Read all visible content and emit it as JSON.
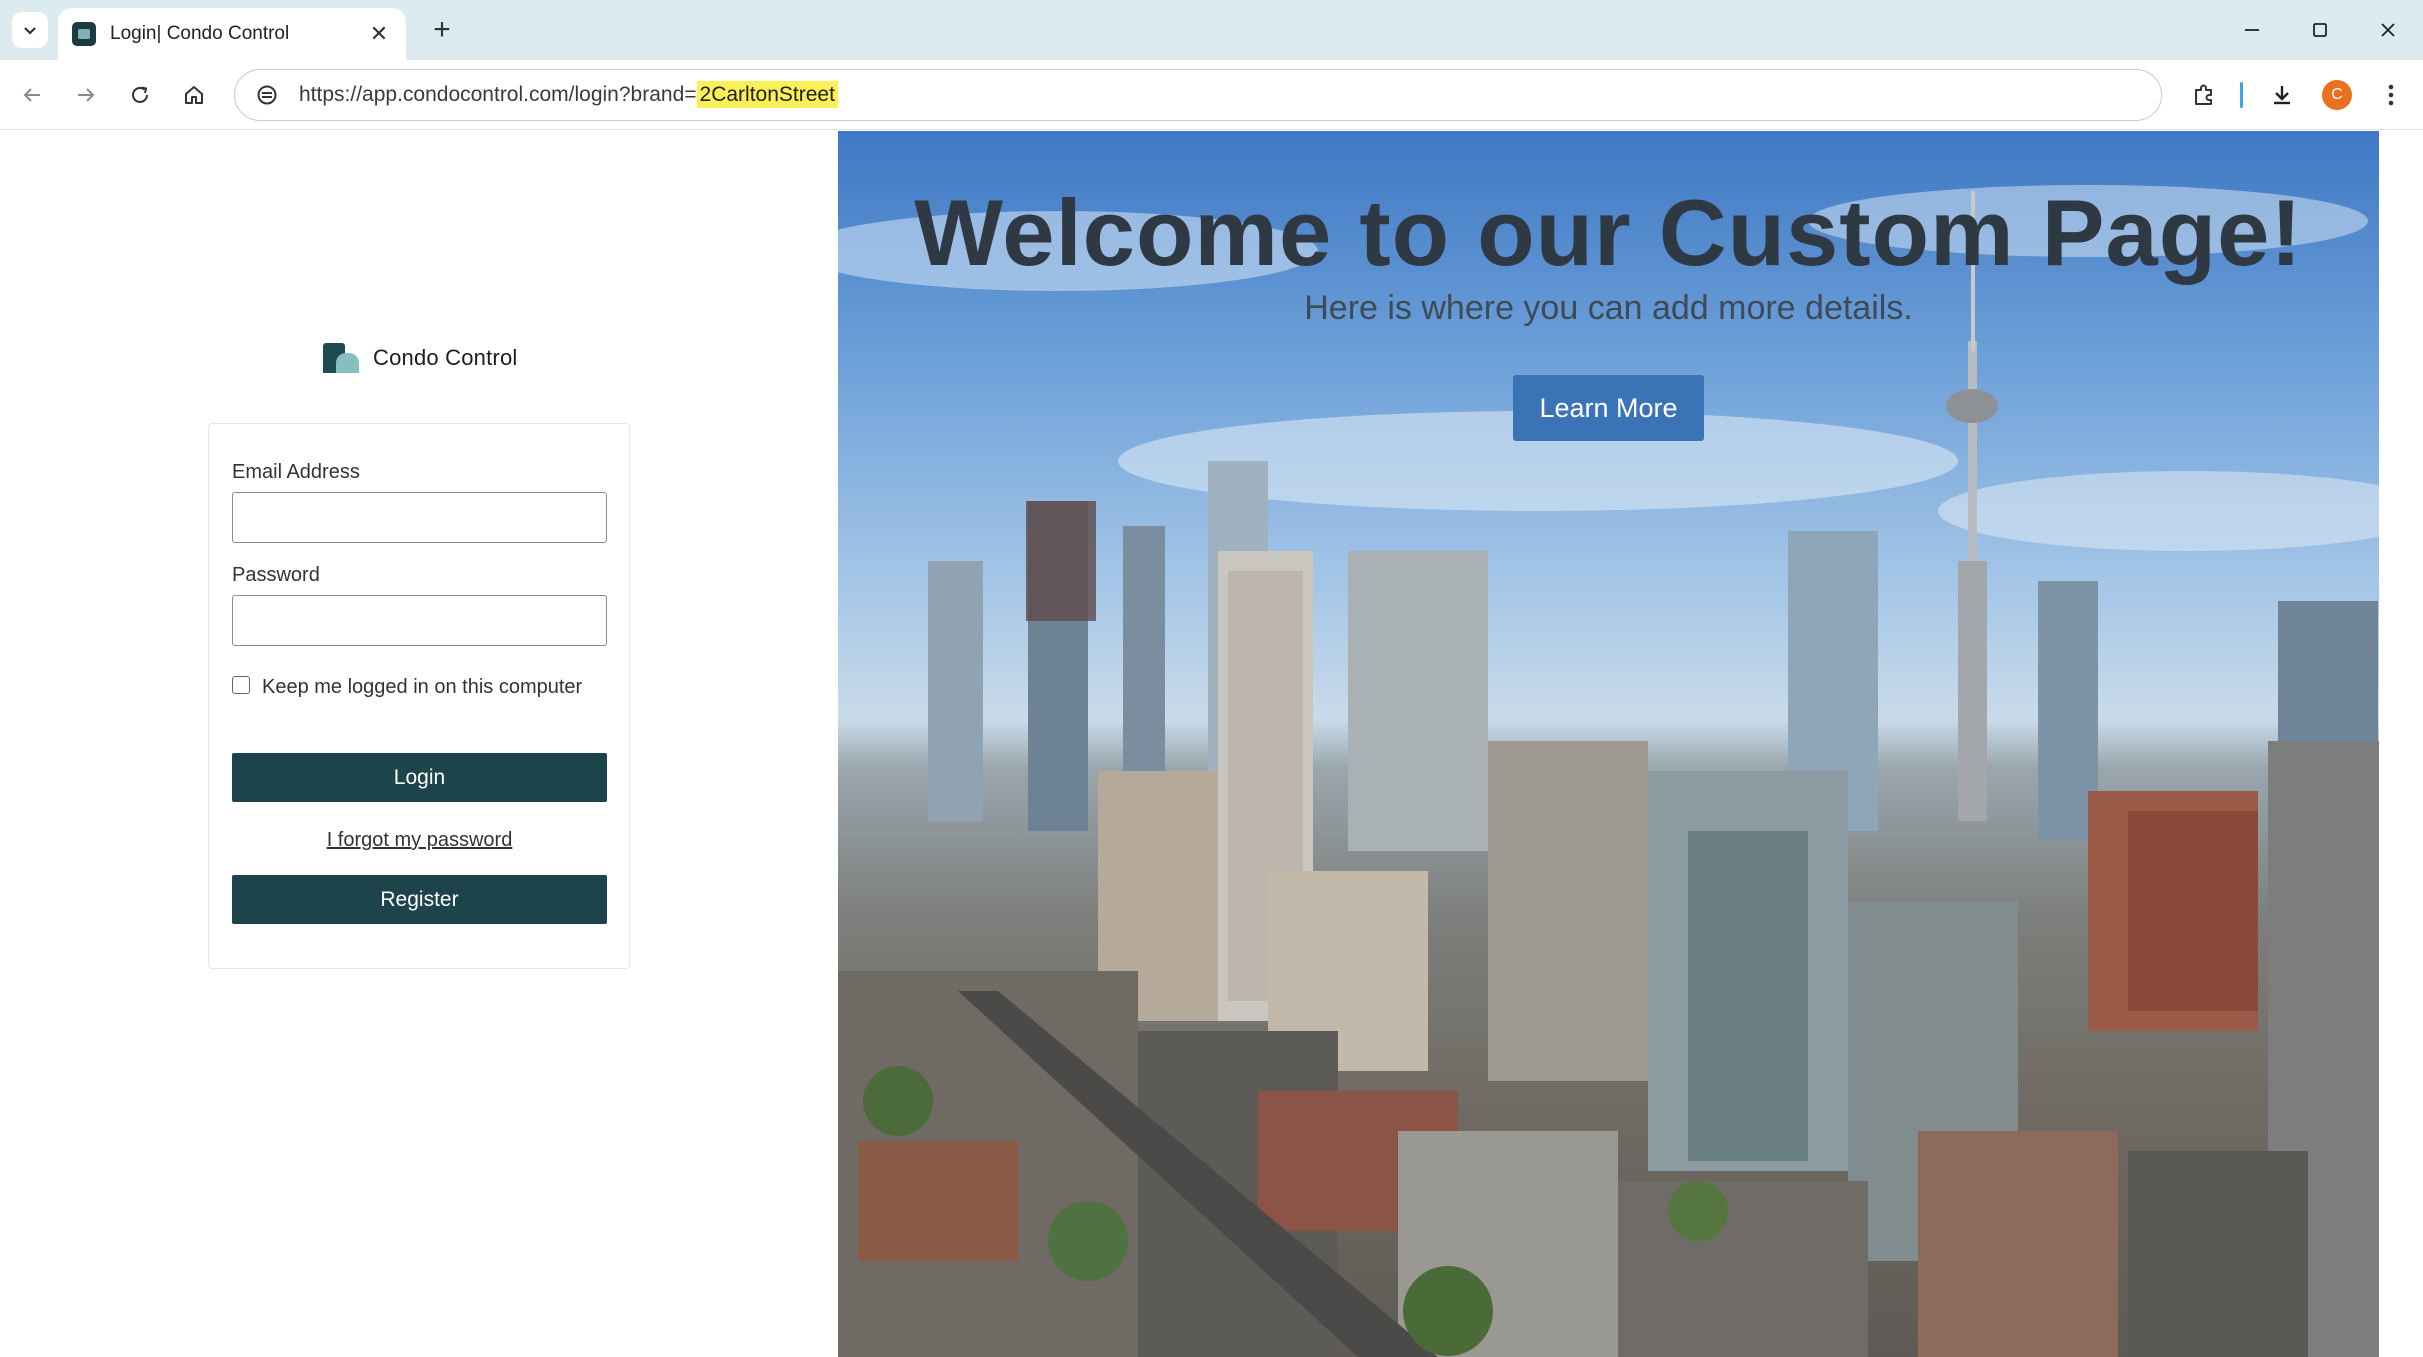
{
  "browser": {
    "tab_title": "Login| Condo Control",
    "url_prefix": "https://app.condocontrol.com/login?brand=",
    "url_highlight": "2CarltonStreet",
    "avatar_letter": "C"
  },
  "brand": {
    "name": "Condo Control"
  },
  "login_form": {
    "email_label": "Email Address",
    "email_value": "",
    "password_label": "Password",
    "password_value": "",
    "keep_logged_in_label": "Keep me logged in on this computer",
    "login_label": "Login",
    "forgot_label": "I forgot my password",
    "register_label": "Register"
  },
  "hero": {
    "title": "Welcome to our Custom Page!",
    "subtitle": "Here is where you can add more details.",
    "button_label": "Learn More"
  },
  "icons": {
    "tab_search": "chevron-down-icon",
    "tab_close": "close-icon",
    "new_tab": "plus-icon",
    "back": "arrow-left-icon",
    "forward": "arrow-right-icon",
    "reload": "reload-icon",
    "home": "home-icon",
    "site_info": "site-info-icon",
    "extensions": "puzzle-icon",
    "downloads": "download-icon",
    "menu": "kebab-menu-icon",
    "minimize": "minimize-icon",
    "maximize": "maximize-icon",
    "close_window": "close-window-icon"
  }
}
